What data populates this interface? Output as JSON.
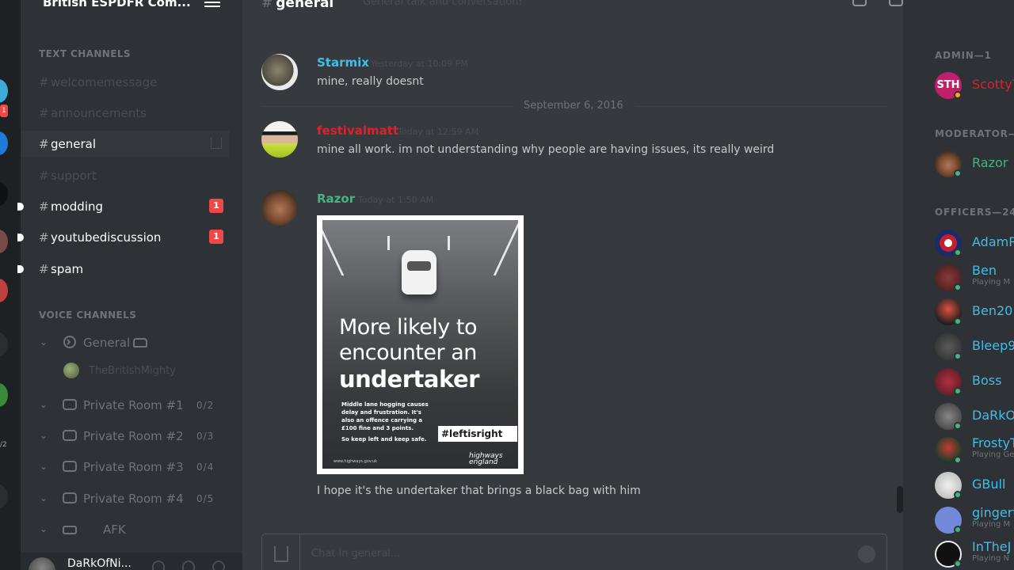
{
  "server": {
    "name": "British ESPDFR Com..."
  },
  "guild_rail": {
    "badges": [
      "1"
    ],
    "labels": [
      "/2"
    ]
  },
  "sidebar": {
    "text_header": "TEXT CHANNELS",
    "text_channels": [
      {
        "label": "welcomemessage",
        "state": "muted"
      },
      {
        "label": "announcements",
        "state": "muted"
      },
      {
        "label": "general",
        "state": "active"
      },
      {
        "label": "support",
        "state": "muted"
      },
      {
        "label": "modding",
        "state": "unread",
        "badge": "1"
      },
      {
        "label": "youtubediscussion",
        "state": "unread",
        "badge": "1"
      },
      {
        "label": "spam",
        "state": "unread"
      }
    ],
    "voice_header": "VOICE CHANNELS",
    "voice_channels": [
      {
        "label": "General",
        "limit": ""
      },
      {
        "label": "Private Room #1",
        "limit": "0/2"
      },
      {
        "label": "Private Room #2",
        "limit": "0/3"
      },
      {
        "label": "Private Room #3",
        "limit": "0/4"
      },
      {
        "label": "Private Room #4",
        "limit": "0/5"
      },
      {
        "label": "AFK",
        "limit": ""
      }
    ],
    "voice_user": "TheBritishMighty",
    "hash_symbol": "#"
  },
  "user_panel": {
    "name": "DaRkOfNi..."
  },
  "chat": {
    "channel": "general",
    "hash_symbol": "#",
    "topic": "General talk and conversation!",
    "date_divider": "September 6, 2016",
    "messages": [
      {
        "author": "Starmix",
        "author_color": "#3fbfe8",
        "timestamp": "Yesterday at 10:09 PM",
        "text": "mine, really doesnt"
      },
      {
        "author": "festivalmatt",
        "author_color": "#e0202a",
        "timestamp": "Today at 12:59 AM",
        "text": "mine all work. im not understanding why people are having issues, its really weird"
      },
      {
        "author": "Razor",
        "author_color": "#43b581",
        "timestamp": "Today at 1:50 AM",
        "text": "I hope it's the undertaker that brings a black bag with him"
      }
    ],
    "attachment": {
      "line1": "More likely to",
      "line2": "encounter an",
      "line3": "undertaker",
      "body": "Middle lane hogging causes delay and frustration. It's also an offence carrying a £100 fine and 3 points.",
      "body2": "So keep left and keep safe.",
      "hashtag": "#leftisright",
      "small": "www.highways.gov.uk",
      "logo": "highways england"
    },
    "composer_placeholder": "Chat in general..."
  },
  "members": {
    "roles": [
      {
        "label": "ADMIN—1"
      },
      {
        "label": "MODERATOR—"
      },
      {
        "label": "OFFICERS—24"
      }
    ],
    "list": [
      {
        "name": "ScottyT",
        "color": "#e0202a",
        "game": "",
        "status": "idle",
        "avatar_color": "#c0206a"
      },
      {
        "name": "Razor",
        "color": "#43b581",
        "game": "",
        "status": "online",
        "avatar_color": "#5a3a2a"
      },
      {
        "name": "AdamR",
        "color": "#3fbfe8",
        "game": "",
        "status": "online",
        "avatar_color": "#b03040"
      },
      {
        "name": "Ben",
        "color": "#3fbfe8",
        "game": "Playing M",
        "status": "online",
        "avatar_color": "#6a2a2a"
      },
      {
        "name": "Ben20",
        "color": "#3fbfe8",
        "game": "",
        "status": "online",
        "avatar_color": "#c04030"
      },
      {
        "name": "Bleep9",
        "color": "#3fbfe8",
        "game": "",
        "status": "online",
        "avatar_color": "#3a3a3a"
      },
      {
        "name": "Boss",
        "color": "#3fbfe8",
        "game": "",
        "status": "online",
        "avatar_color": "#8a2a30"
      },
      {
        "name": "DaRkO",
        "color": "#3fbfe8",
        "game": "",
        "status": "online",
        "avatar_color": "#555555"
      },
      {
        "name": "FrostyT",
        "color": "#3fbfe8",
        "game": "Playing Ge",
        "status": "online",
        "avatar_color": "#2a5a3a"
      },
      {
        "name": "GBull",
        "color": "#3fbfe8",
        "game": "",
        "status": "online",
        "avatar_color": "#c8c8c8"
      },
      {
        "name": "gingert",
        "color": "#3fbfe8",
        "game": "Playing M",
        "status": "online",
        "avatar_color": "#7289da"
      },
      {
        "name": "InTheJ",
        "color": "#3fbfe8",
        "game": "Playing N",
        "status": "online",
        "avatar_color": "#111111"
      }
    ]
  }
}
